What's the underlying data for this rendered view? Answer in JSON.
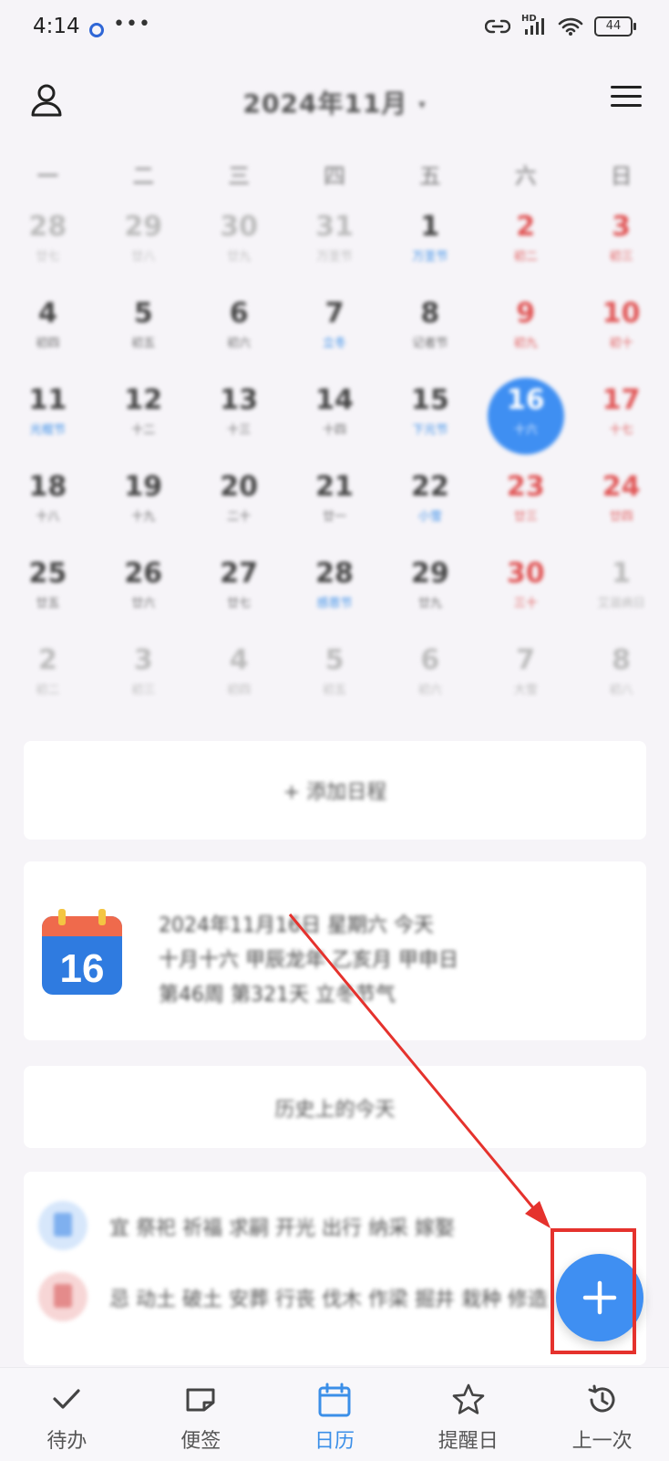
{
  "status": {
    "time": "4:14",
    "battery": "44",
    "hd": "HD"
  },
  "header": {
    "title": "2024年11月",
    "caret": "▾"
  },
  "weekdays": [
    "一",
    "二",
    "三",
    "四",
    "五",
    "六",
    "日"
  ],
  "calendar": {
    "weeks": [
      [
        {
          "num": "28",
          "sub": "廿七",
          "kind": "other"
        },
        {
          "num": "29",
          "sub": "廿八",
          "kind": "other"
        },
        {
          "num": "30",
          "sub": "廿九",
          "kind": "other"
        },
        {
          "num": "31",
          "sub": "万圣节",
          "kind": "other"
        },
        {
          "num": "1",
          "sub": "万圣节",
          "kind": "blue-sub"
        },
        {
          "num": "2",
          "sub": "初二",
          "kind": "red"
        },
        {
          "num": "3",
          "sub": "初三",
          "kind": "red"
        }
      ],
      [
        {
          "num": "4",
          "sub": "初四",
          "kind": ""
        },
        {
          "num": "5",
          "sub": "初五",
          "kind": ""
        },
        {
          "num": "6",
          "sub": "初六",
          "kind": ""
        },
        {
          "num": "7",
          "sub": "立冬",
          "kind": "blue-sub"
        },
        {
          "num": "8",
          "sub": "记者节",
          "kind": ""
        },
        {
          "num": "9",
          "sub": "初九",
          "kind": "red"
        },
        {
          "num": "10",
          "sub": "初十",
          "kind": "red"
        }
      ],
      [
        {
          "num": "11",
          "sub": "光棍节",
          "kind": "blue-sub"
        },
        {
          "num": "12",
          "sub": "十二",
          "kind": ""
        },
        {
          "num": "13",
          "sub": "十三",
          "kind": ""
        },
        {
          "num": "14",
          "sub": "十四",
          "kind": ""
        },
        {
          "num": "15",
          "sub": "下元节",
          "kind": "blue-sub"
        },
        {
          "num": "16",
          "sub": "十六",
          "kind": "today"
        },
        {
          "num": "17",
          "sub": "十七",
          "kind": "red"
        }
      ],
      [
        {
          "num": "18",
          "sub": "十八",
          "kind": ""
        },
        {
          "num": "19",
          "sub": "十九",
          "kind": ""
        },
        {
          "num": "20",
          "sub": "二十",
          "kind": ""
        },
        {
          "num": "21",
          "sub": "廿一",
          "kind": ""
        },
        {
          "num": "22",
          "sub": "小雪",
          "kind": "blue-sub"
        },
        {
          "num": "23",
          "sub": "廿三",
          "kind": "red"
        },
        {
          "num": "24",
          "sub": "廿四",
          "kind": "red"
        }
      ],
      [
        {
          "num": "25",
          "sub": "廿五",
          "kind": ""
        },
        {
          "num": "26",
          "sub": "廿六",
          "kind": ""
        },
        {
          "num": "27",
          "sub": "廿七",
          "kind": ""
        },
        {
          "num": "28",
          "sub": "感恩节",
          "kind": "blue-sub"
        },
        {
          "num": "29",
          "sub": "廿九",
          "kind": ""
        },
        {
          "num": "30",
          "sub": "三十",
          "kind": "red"
        },
        {
          "num": "1",
          "sub": "艾滋病日",
          "kind": "other"
        }
      ],
      [
        {
          "num": "2",
          "sub": "初二",
          "kind": "other"
        },
        {
          "num": "3",
          "sub": "初三",
          "kind": "other"
        },
        {
          "num": "4",
          "sub": "初四",
          "kind": "other"
        },
        {
          "num": "5",
          "sub": "初五",
          "kind": "other"
        },
        {
          "num": "6",
          "sub": "初六",
          "kind": "other"
        },
        {
          "num": "7",
          "sub": "大雪",
          "kind": "other"
        },
        {
          "num": "8",
          "sub": "初八",
          "kind": "other"
        }
      ]
    ]
  },
  "add_card": {
    "label": "+ 添加日程"
  },
  "info_card": {
    "icon_day": "16",
    "lines": [
      "2024年11月16日 星期六 今天",
      "十月十六 甲辰龙年 乙亥月 甲申日",
      "第46周 第321天 立冬节气"
    ]
  },
  "history_card": {
    "label": "历史上的今天"
  },
  "list_items": [
    {
      "text": "宜 祭祀 祈福 求嗣 开光 出行 纳采 嫁娶",
      "tone": "blue"
    },
    {
      "text": "忌 动土 破土 安葬 行丧 伐木 作梁 掘井 栽种 修造",
      "tone": "red"
    }
  ],
  "nav": [
    {
      "label": "待办",
      "icon": "check-icon"
    },
    {
      "label": "便签",
      "icon": "note-icon"
    },
    {
      "label": "日历",
      "icon": "calendar-icon",
      "active": true
    },
    {
      "label": "提醒日",
      "icon": "star-icon"
    },
    {
      "label": "上一次",
      "icon": "history-icon"
    }
  ],
  "colors": {
    "accent": "#3f8ff2",
    "annotation": "#e5322d",
    "holiday": "#e05555"
  }
}
